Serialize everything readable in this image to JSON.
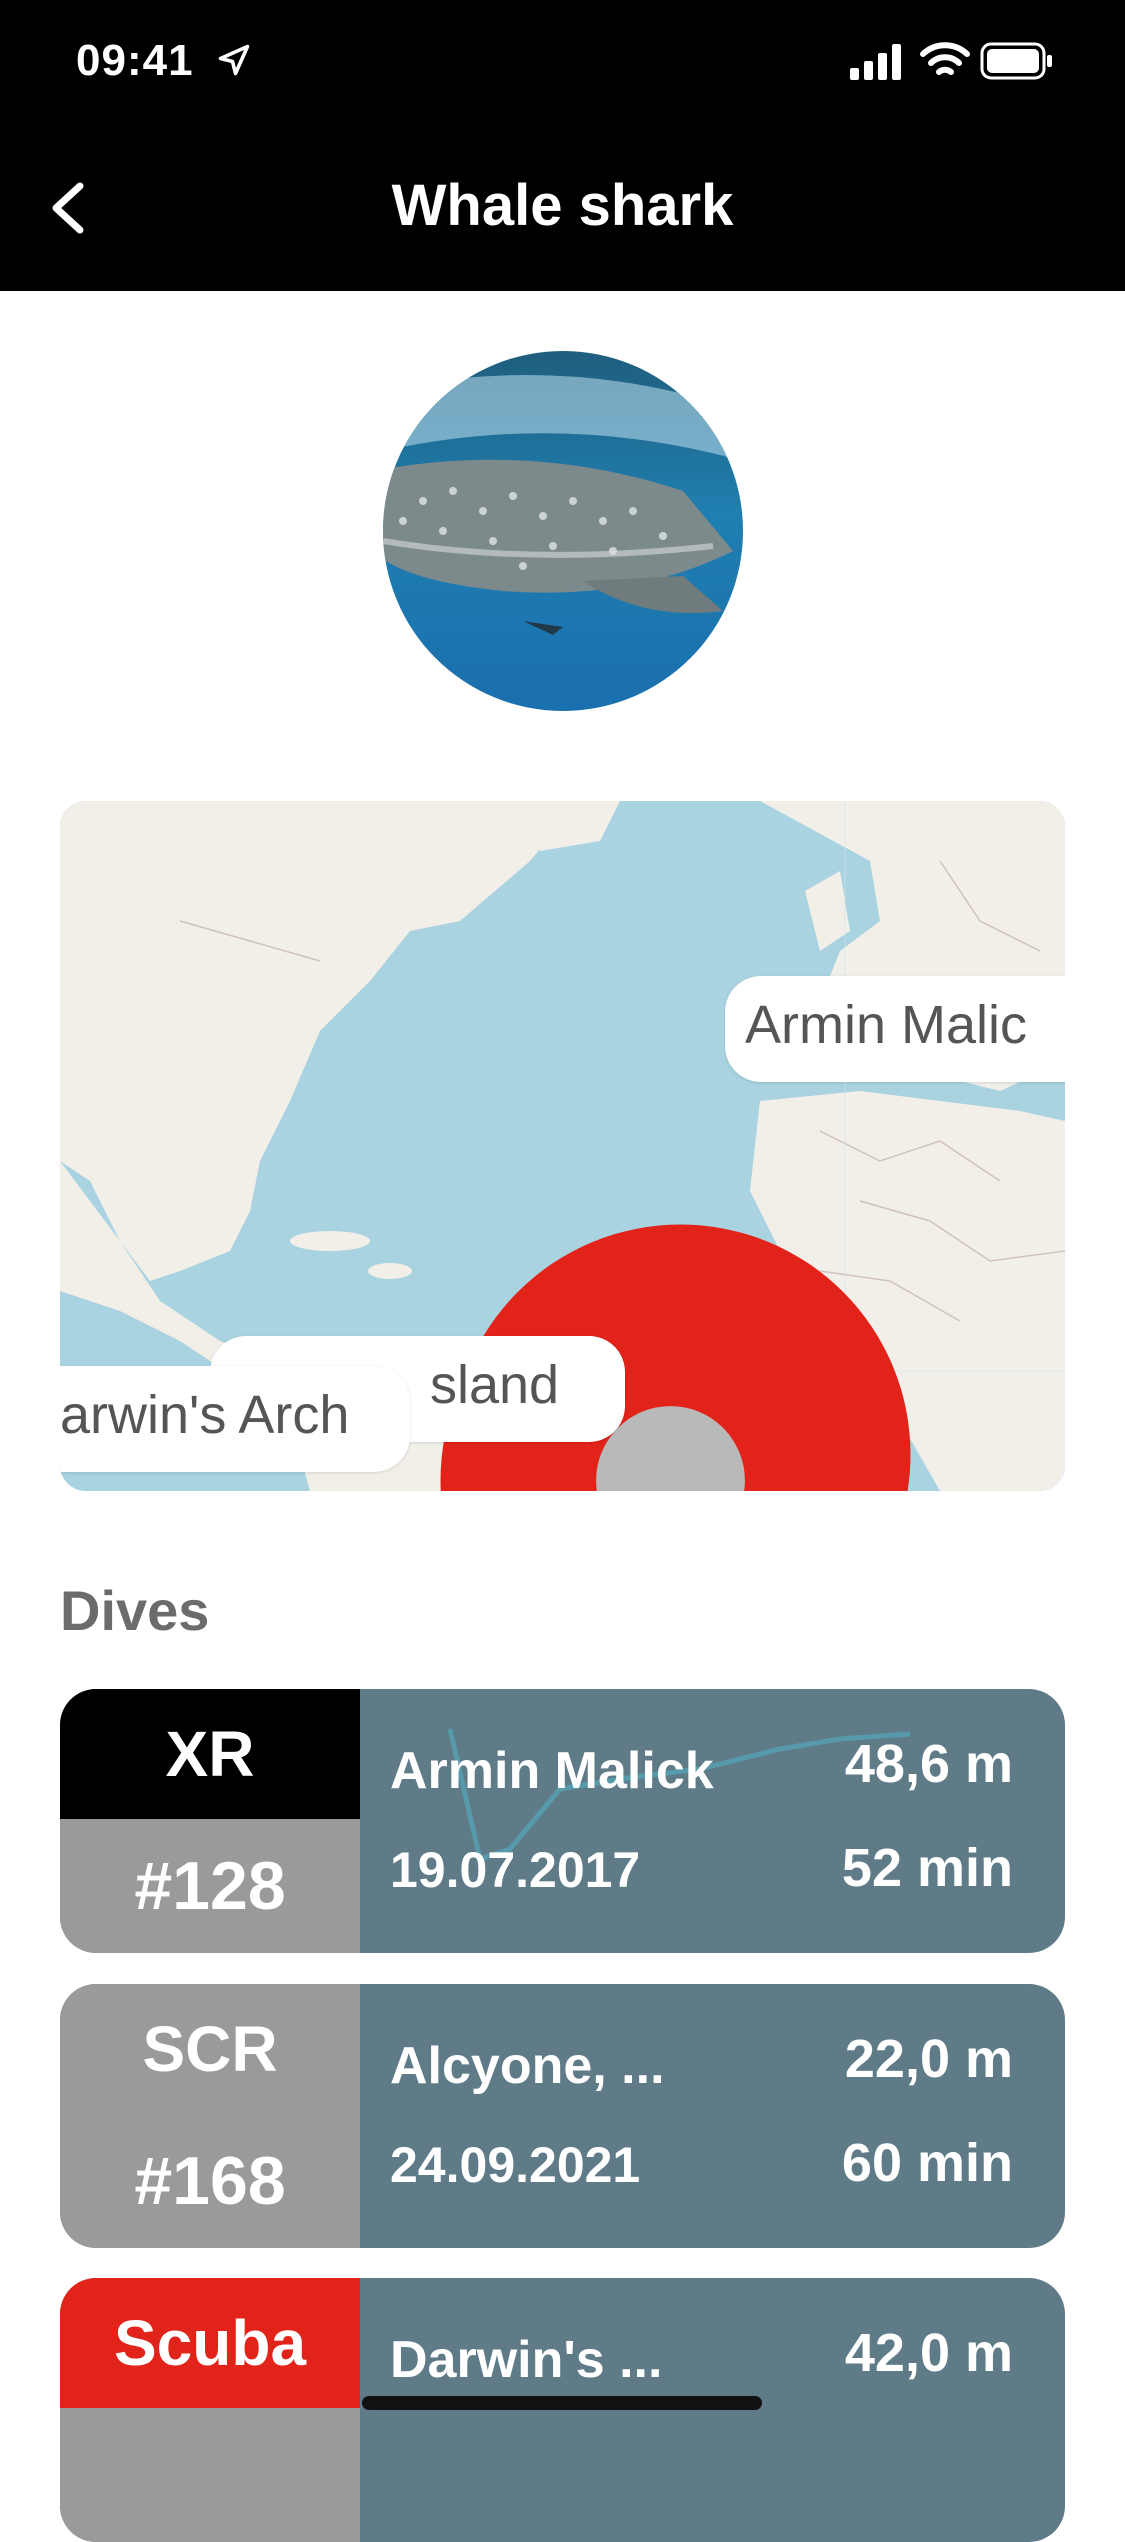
{
  "status_bar": {
    "time": "09:41"
  },
  "nav": {
    "title": "Whale shark"
  },
  "map": {
    "labels": [
      "Armin Malic",
      "sland",
      "arwin's Arch"
    ]
  },
  "section": {
    "title": "Dives"
  },
  "dives": [
    {
      "type": "XR",
      "number": "#128",
      "location": "Armin Malick",
      "date": "19.07.2017",
      "depth": "48,6 m",
      "duration": "52 min",
      "type_color": "#000000"
    },
    {
      "type": "SCR",
      "number": "#168",
      "location": "Alcyone, ...",
      "date": "24.09.2021",
      "depth": "22,0 m",
      "duration": "60 min",
      "type_color": "#9a9a9a"
    },
    {
      "type": "Scuba",
      "number": "",
      "location": "Darwin's ...",
      "date": "",
      "depth": "42,0 m",
      "duration": "",
      "type_color": "#e2231a"
    }
  ],
  "colors": {
    "pin": "#e2231a",
    "card_bg": "#5f7b88",
    "ocean": "#a9d3e0",
    "land": "#f2efe9"
  }
}
